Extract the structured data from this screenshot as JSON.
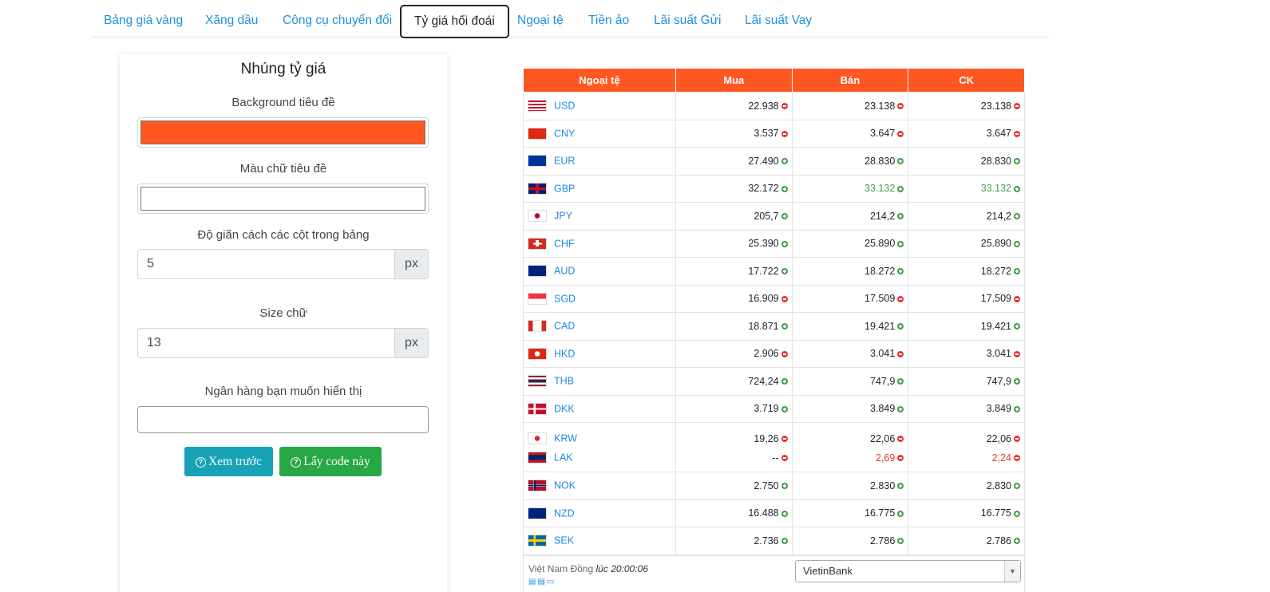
{
  "tabs": [
    {
      "label": "Bảng giá vàng",
      "active": false
    },
    {
      "label": "Xăng dầu",
      "active": false
    },
    {
      "label": "Công cụ chuyển đổi",
      "active": false
    },
    {
      "label": "Tỷ giá hối đoái",
      "active": true
    },
    {
      "label": "Ngoại tệ",
      "active": false
    },
    {
      "label": "Tiền ảo",
      "active": false
    },
    {
      "label": "Lãi suất Gửi",
      "active": false
    },
    {
      "label": "Lãi suất Vay",
      "active": false
    }
  ],
  "embed": {
    "title": "Nhúng tỷ giá",
    "bg_label": "Background tiêu đề",
    "bg_color": "#ff5722",
    "text_color_label": "Màu chữ tiêu đề",
    "text_color": "#ffffff",
    "spacing_label": "Độ giãn cách các cột trong bảng",
    "spacing_value": "5",
    "spacing_unit": "px",
    "size_label": "Size chữ",
    "size_value": "13",
    "size_unit": "px",
    "bank_label": "Ngân hàng bạn muốn hiển thị",
    "bank_value": "",
    "preview_label": "Xem trước",
    "getcode_label": "Lấy code này"
  },
  "table": {
    "headers": [
      "Ngoại tệ",
      "Mua",
      "Bán",
      "CK"
    ],
    "rows": [
      {
        "code": "USD",
        "flag": "us-flag-icon",
        "buy": "22.938",
        "buy_dir": "down",
        "sell": "23.138",
        "sell_dir": "down",
        "ck": "23.138",
        "ck_dir": "down",
        "sell_color": "",
        "ck_color": ""
      },
      {
        "code": "CNY",
        "flag": "cn-flag-icon",
        "buy": "3.537",
        "buy_dir": "down",
        "sell": "3.647",
        "sell_dir": "down",
        "ck": "3.647",
        "ck_dir": "down",
        "sell_color": "",
        "ck_color": ""
      },
      {
        "code": "EUR",
        "flag": "eu-flag-icon",
        "buy": "27.490",
        "buy_dir": "up",
        "sell": "28.830",
        "sell_dir": "up",
        "ck": "28.830",
        "ck_dir": "up",
        "sell_color": "",
        "ck_color": ""
      },
      {
        "code": "GBP",
        "flag": "gb-flag-icon",
        "buy": "32.172",
        "buy_dir": "up",
        "sell": "33.132",
        "sell_dir": "up",
        "ck": "33.132",
        "ck_dir": "up",
        "sell_color": "up",
        "ck_color": "up"
      },
      {
        "code": "JPY",
        "flag": "jp-flag-icon",
        "buy": "205,7",
        "buy_dir": "up",
        "sell": "214,2",
        "sell_dir": "up",
        "ck": "214,2",
        "ck_dir": "up",
        "sell_color": "",
        "ck_color": ""
      },
      {
        "code": "CHF",
        "flag": "ch-flag-icon",
        "buy": "25.390",
        "buy_dir": "up",
        "sell": "25.890",
        "sell_dir": "up",
        "ck": "25.890",
        "ck_dir": "up",
        "sell_color": "",
        "ck_color": ""
      },
      {
        "code": "AUD",
        "flag": "au-flag-icon",
        "buy": "17.722",
        "buy_dir": "up",
        "sell": "18.272",
        "sell_dir": "up",
        "ck": "18.272",
        "ck_dir": "up",
        "sell_color": "",
        "ck_color": ""
      },
      {
        "code": "SGD",
        "flag": "sg-flag-icon",
        "buy": "16.909",
        "buy_dir": "down",
        "sell": "17.509",
        "sell_dir": "down",
        "ck": "17.509",
        "ck_dir": "down",
        "sell_color": "",
        "ck_color": ""
      },
      {
        "code": "CAD",
        "flag": "ca-flag-icon",
        "buy": "18.871",
        "buy_dir": "up",
        "sell": "19.421",
        "sell_dir": "up",
        "ck": "19.421",
        "ck_dir": "up",
        "sell_color": "",
        "ck_color": ""
      },
      {
        "code": "HKD",
        "flag": "hk-flag-icon",
        "buy": "2.906",
        "buy_dir": "down",
        "sell": "3.041",
        "sell_dir": "down",
        "ck": "3.041",
        "ck_dir": "down",
        "sell_color": "",
        "ck_color": ""
      },
      {
        "code": "THB",
        "flag": "th-flag-icon",
        "buy": "724,24",
        "buy_dir": "up",
        "sell": "747,9",
        "sell_dir": "up",
        "ck": "747,9",
        "ck_dir": "up",
        "sell_color": "",
        "ck_color": ""
      },
      {
        "code": "DKK",
        "flag": "dk-flag-icon",
        "buy": "3.719",
        "buy_dir": "up",
        "sell": "3.849",
        "sell_dir": "up",
        "ck": "3.849",
        "ck_dir": "up",
        "sell_color": "",
        "ck_color": ""
      },
      {
        "code": "KRW",
        "flag": "kr-flag-icon",
        "buy": "19,26",
        "buy_dir": "down",
        "sell": "22,06",
        "sell_dir": "down",
        "ck": "22,06",
        "ck_dir": "down",
        "sell_color": "",
        "ck_color": "",
        "code2": "LAK",
        "flag2": "la-flag-icon",
        "buy2": "--",
        "buy2_dir": "down",
        "sell2": "2,69",
        "sell2_dir": "down",
        "ck2": "2,24",
        "ck2_dir": "down"
      },
      {
        "code": "NOK",
        "flag": "no-flag-icon",
        "buy": "2.750",
        "buy_dir": "up",
        "sell": "2.830",
        "sell_dir": "up",
        "ck": "2.830",
        "ck_dir": "up",
        "sell_color": "",
        "ck_color": ""
      },
      {
        "code": "NZD",
        "flag": "nz-flag-icon",
        "buy": "16.488",
        "buy_dir": "up",
        "sell": "16.775",
        "sell_dir": "up",
        "ck": "16.775",
        "ck_dir": "up",
        "sell_color": "",
        "ck_color": ""
      },
      {
        "code": "SEK",
        "flag": "se-flag-icon",
        "buy": "2.736",
        "buy_dir": "up",
        "sell": "2.786",
        "sell_dir": "up",
        "ck": "2.786",
        "ck_dir": "up",
        "sell_color": "",
        "ck_color": ""
      }
    ],
    "footer_note": "Việt Nam Đồng",
    "footer_time_prefix": "lúc",
    "footer_time": "20:00:06",
    "bank_selected": "VietinBank"
  }
}
